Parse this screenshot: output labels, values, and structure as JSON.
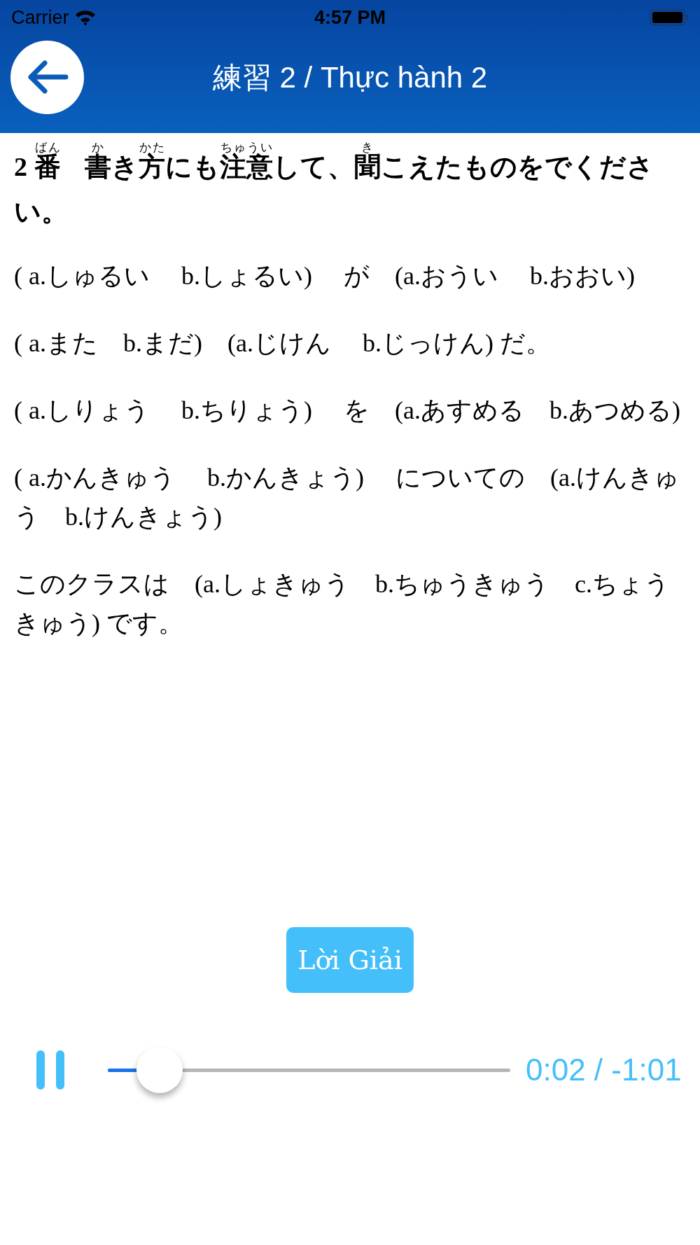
{
  "status_bar": {
    "carrier": "Carrier",
    "time": "4:57 PM"
  },
  "header": {
    "title": "練習 2 / Thực hành 2"
  },
  "question": {
    "segments": [
      {
        "text": "2 "
      },
      {
        "text": "番",
        "ruby": "ばん",
        "space_after": true
      },
      {
        "text": "書",
        "ruby": "か"
      },
      {
        "text": "き"
      },
      {
        "text": "方",
        "ruby": "かた"
      },
      {
        "text": "にも"
      },
      {
        "text": "注意",
        "ruby": "ちゅうい"
      },
      {
        "text": "して、"
      },
      {
        "text": "聞",
        "ruby": "き"
      },
      {
        "text": "こえたものをでください。"
      }
    ]
  },
  "lines": [
    "( a.しゅるい　 b.しょるい)　 が　(a.おうい　 b.おおい)",
    "( a.また　b.まだ)　(a.じけん　 b.じっけん) だ。",
    "( a.しりょう　 b.ちりょう)　 を　(a.あすめる　b.あつめる)",
    "( a.かんきゅう　 b.かんきょう)　 についての　(a.けんきゅう　b.けんきょう)",
    "このクラスは　(a.しょきゅう　b.ちゅうきゅう　c.ちょうきゅう) です。"
  ],
  "answer_button": {
    "label": "Lời Giải"
  },
  "player": {
    "playing": true,
    "level": 0.08,
    "time": "0:02 / -1:01"
  }
}
